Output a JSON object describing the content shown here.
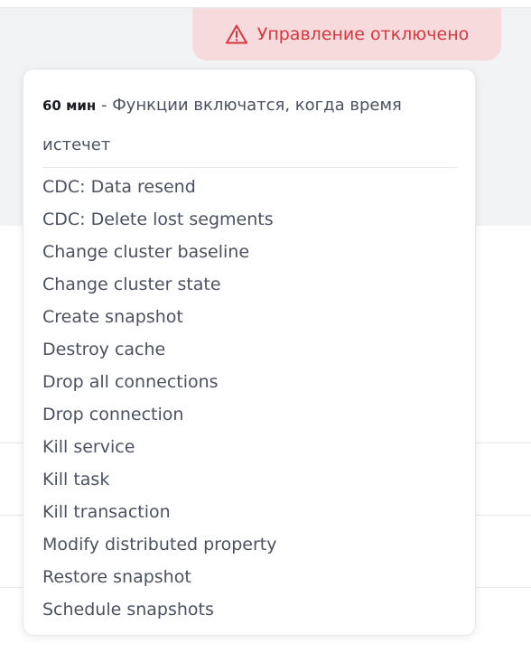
{
  "badge": {
    "icon": "warning-icon",
    "label": "Управление отключено",
    "color": "#d9363e",
    "background": "#f7dadb"
  },
  "popover": {
    "duration": "60 мин",
    "separator": " - ",
    "message": "Функции включатся, когда время истечет",
    "features": [
      "CDC: Data resend",
      "CDC: Delete lost segments",
      "Change cluster baseline",
      "Change cluster state",
      "Create snapshot",
      "Destroy cache",
      "Drop all connections",
      "Drop connection",
      "Kill service",
      "Kill task",
      "Kill transaction",
      "Modify distributed property",
      "Restore snapshot",
      "Schedule snapshots"
    ]
  }
}
